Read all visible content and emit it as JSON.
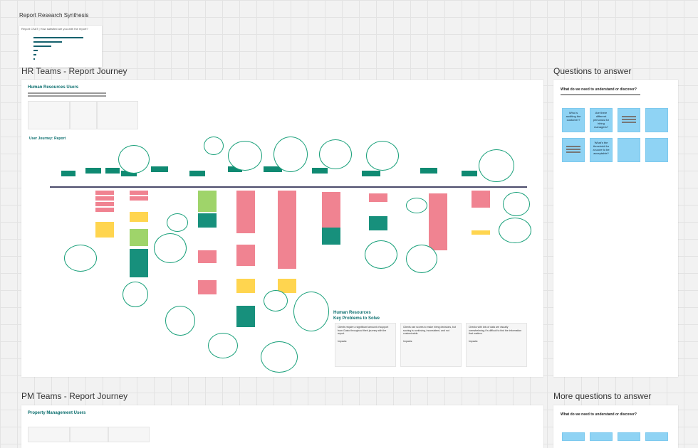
{
  "frames": {
    "synthesis": {
      "title": "Report Research Synthesis",
      "panel_title": "Report CSAT | How satisfied are you with the report?"
    },
    "hr": {
      "title": "HR Teams - Report Journey"
    },
    "questions": {
      "title": "Questions to answer"
    },
    "pm": {
      "title": "PM Teams - Report Journey"
    },
    "more_questions": {
      "title": "More questions to answer"
    }
  },
  "hr_board": {
    "heading": "Human Resources Users",
    "journey_label": "User Journey: Report",
    "problems_title": "Human Resources\nKey Problems to Solve",
    "problems": [
      {
        "text": "Clients require a significant amount of support from Gusto throughout their journey with the report.",
        "impact_label": "Impacts:"
      },
      {
        "text": "Clients use scores to make hiring decisions, but scoring is confusing, inconsistent, and not customizable.",
        "impact_label": "Impacts:"
      },
      {
        "text": "Checks with lots of data are visually overwhelming; it's difficult to find the information that matters.",
        "impact_label": "Impacts:"
      }
    ]
  },
  "questions_board": {
    "heading": "What do we need to understand or discover?",
    "stickies": [
      {
        "text": "Who is auditing the customer?"
      },
      {
        "text": "Are there different personas for hiring managers?"
      },
      {
        "text": ""
      },
      {
        "text": ""
      },
      {
        "text": ""
      },
      {
        "text": "What's the threshold for a score to be acceptable?"
      },
      {
        "text": ""
      },
      {
        "text": ""
      }
    ]
  },
  "pm_board": {
    "heading": "Property Management Users"
  },
  "more_questions_board": {
    "heading": "What do we need to understand or discover?"
  },
  "colors": {
    "teal": "#0b6e6e",
    "sticky_blue": "#8fd3f4",
    "red_note": "#f08391",
    "yellow_note": "#ffd54f",
    "green_note": "#9fd46a"
  }
}
